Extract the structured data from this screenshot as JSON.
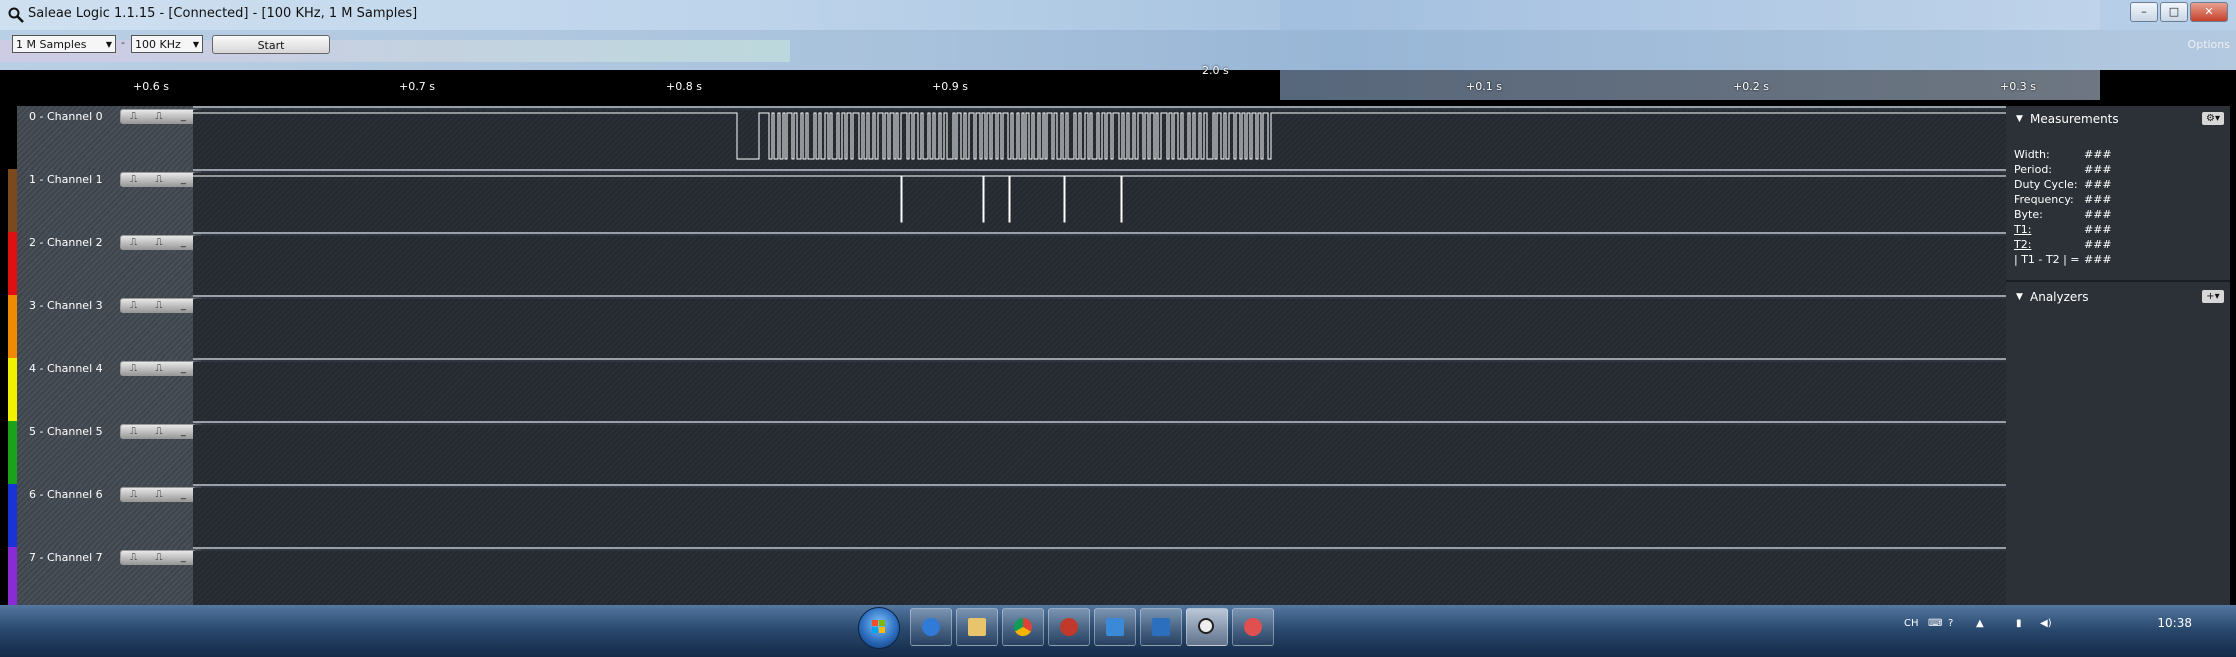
{
  "window": {
    "title": "Saleae Logic 1.1.15 - [Connected] - [100 KHz, 1 M Samples]",
    "buttons": [
      "–",
      "□",
      "✕"
    ]
  },
  "toolbar": {
    "samples_select": "1 M Samples",
    "rate_select": "100 KHz",
    "start_label": "Start",
    "options_label": "Options"
  },
  "timeline": {
    "center_label": "2.0 s",
    "ticks": [
      "+0.6 s",
      "+0.7 s",
      "+0.8 s",
      "+0.9 s",
      "+0.1 s",
      "+0.2 s",
      "+0.3 s"
    ]
  },
  "channels": [
    {
      "label": "0 - Channel 0",
      "color": "#000000"
    },
    {
      "label": "1 - Channel 1",
      "color": "#7a4a1e"
    },
    {
      "label": "2 - Channel 2",
      "color": "#e01010"
    },
    {
      "label": "3 - Channel 3",
      "color": "#f08a00"
    },
    {
      "label": "4 - Channel 4",
      "color": "#f2f200"
    },
    {
      "label": "5 - Channel 5",
      "color": "#1aa31a"
    },
    {
      "label": "6 - Channel 6",
      "color": "#1a33d6"
    },
    {
      "label": "7 - Channel 7",
      "color": "#8a2bd6"
    }
  ],
  "measurements": {
    "title": "Measurements",
    "rows": [
      {
        "k": "Width:",
        "v": "###"
      },
      {
        "k": "Period:",
        "v": "###"
      },
      {
        "k": "Duty Cycle:",
        "v": "###"
      },
      {
        "k": "Frequency:",
        "v": "###"
      },
      {
        "k": "Byte:",
        "v": "###"
      },
      {
        "k": "T1:",
        "v": "###"
      },
      {
        "k": "T2:",
        "v": "###"
      },
      {
        "k": "| T1 - T2 | =",
        "v": "###"
      }
    ]
  },
  "analyzers": {
    "title": "Analyzers"
  },
  "taskbar": {
    "clock": "10:38",
    "lang": "CH"
  }
}
